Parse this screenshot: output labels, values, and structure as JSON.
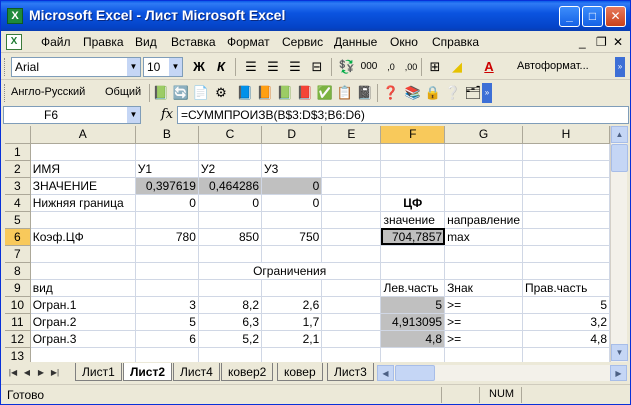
{
  "window": {
    "title": "Microsoft Excel - Лист Microsoft Excel"
  },
  "menu": [
    "Файл",
    "Правка",
    "Вид",
    "Вставка",
    "Формат",
    "Сервис",
    "Данные",
    "Окно",
    "Справка"
  ],
  "toolbar1": {
    "font": "Arial",
    "size": "10",
    "autoformat": "Автоформат..."
  },
  "toolbar2": {
    "language": "Англо-Русский",
    "general": "Общий"
  },
  "formula_bar": {
    "cell": "F6",
    "fx": "fx",
    "formula": "=СУММПРОИЗВ(B$3:D$3;B6:D6)"
  },
  "columns": [
    "A",
    "B",
    "C",
    "D",
    "E",
    "F",
    "G",
    "H"
  ],
  "rows": [
    {
      "n": "1",
      "cells": [
        "",
        "",
        "",
        "",
        "",
        "",
        "",
        ""
      ]
    },
    {
      "n": "2",
      "cells": [
        "ИМЯ",
        "У1",
        "У2",
        "У3",
        "",
        "",
        "",
        ""
      ]
    },
    {
      "n": "3",
      "cells": [
        "ЗНАЧЕНИЕ",
        "0,397619",
        "0,464286",
        "0",
        "",
        "",
        "",
        ""
      ]
    },
    {
      "n": "4",
      "cells": [
        "Нижняя граница",
        "0",
        "0",
        "0",
        "",
        "ЦФ",
        "",
        ""
      ]
    },
    {
      "n": "5",
      "cells": [
        "",
        "",
        "",
        "",
        "",
        "значение",
        "направление",
        ""
      ]
    },
    {
      "n": "6",
      "cells": [
        "Коэф.ЦФ",
        "780",
        "850",
        "750",
        "",
        "704,7857",
        "max",
        ""
      ]
    },
    {
      "n": "7",
      "cells": [
        "",
        "",
        "",
        "",
        "",
        "",
        "",
        ""
      ]
    },
    {
      "n": "8",
      "cells": [
        "",
        "",
        "Ограничения",
        "",
        "",
        "",
        "",
        ""
      ]
    },
    {
      "n": "9",
      "cells": [
        "вид",
        "",
        "",
        "",
        "",
        "Лев.часть",
        "Знак",
        "Прав.часть"
      ]
    },
    {
      "n": "10",
      "cells": [
        "Огран.1",
        "3",
        "8,2",
        "2,6",
        "",
        "5",
        ">=",
        "5"
      ]
    },
    {
      "n": "11",
      "cells": [
        "Огран.2",
        "5",
        "6,3",
        "1,7",
        "",
        "4,913095",
        ">=",
        "3,2"
      ]
    },
    {
      "n": "12",
      "cells": [
        "Огран.3",
        "6",
        "5,2",
        "2,1",
        "",
        "4,8",
        ">=",
        "4,8"
      ]
    },
    {
      "n": "13",
      "cells": [
        "",
        "",
        "",
        "",
        "",
        "",
        "",
        ""
      ]
    }
  ],
  "sheets": [
    "Лист1",
    "Лист2",
    "Лист4",
    "ковер2",
    "ковер",
    "Лист3"
  ],
  "active_sheet": "Лист2",
  "status": {
    "text": "Готово",
    "num": "NUM"
  }
}
